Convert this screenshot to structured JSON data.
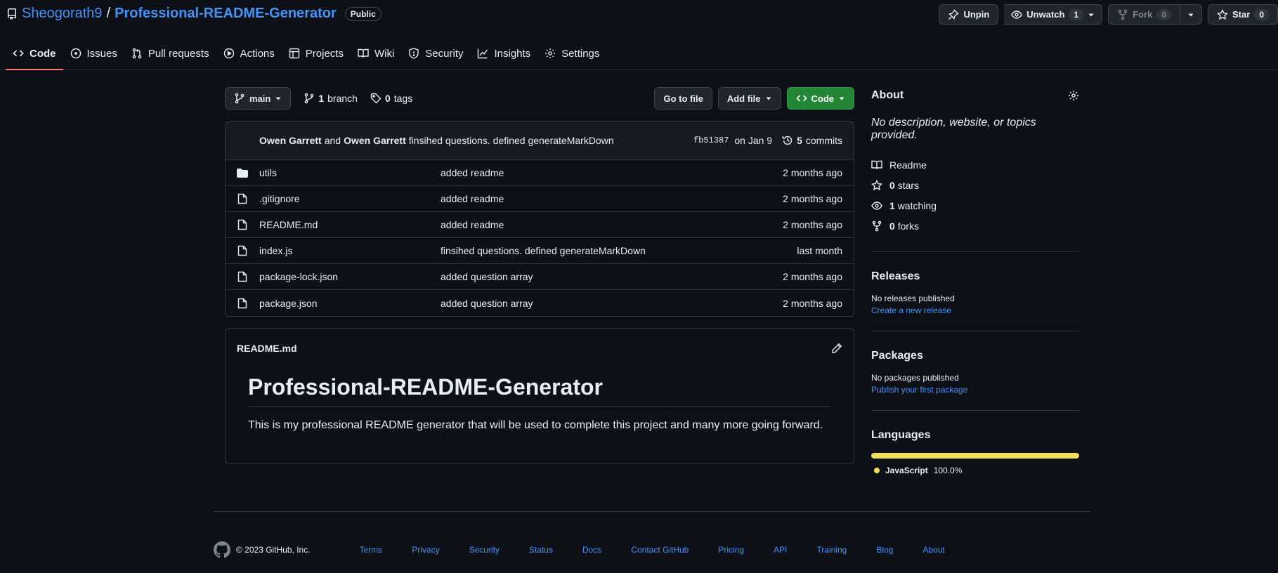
{
  "repo": {
    "owner": "Sheogorath9",
    "separator": "/",
    "name": "Professional-README-Generator",
    "visibility": "Public"
  },
  "actions": {
    "unpin": "Unpin",
    "unwatch": "Unwatch",
    "watch_count": "1",
    "fork": "Fork",
    "fork_count": "0",
    "star": "Star",
    "star_count": "0"
  },
  "tabs": [
    {
      "label": "Code"
    },
    {
      "label": "Issues"
    },
    {
      "label": "Pull requests"
    },
    {
      "label": "Actions"
    },
    {
      "label": "Projects"
    },
    {
      "label": "Wiki"
    },
    {
      "label": "Security"
    },
    {
      "label": "Insights"
    },
    {
      "label": "Settings"
    }
  ],
  "toolbar": {
    "branch": "main",
    "branch_count": "1",
    "branch_label": "branch",
    "tag_count": "0",
    "tag_label": "tags",
    "go_to_file": "Go to file",
    "add_file": "Add file",
    "code": "Code"
  },
  "commit": {
    "author1": "Owen Garrett",
    "and": "and",
    "author2": "Owen Garrett",
    "message": "finsihed questions. defined generateMarkDown",
    "sha": "fb51387",
    "date": "on Jan 9",
    "count": "5",
    "count_label": "commits"
  },
  "files": [
    {
      "type": "folder",
      "name": "utils",
      "message": "added readme",
      "age": "2 months ago"
    },
    {
      "type": "file",
      "name": ".gitignore",
      "message": "added readme",
      "age": "2 months ago"
    },
    {
      "type": "file",
      "name": "README.md",
      "message": "added readme",
      "age": "2 months ago"
    },
    {
      "type": "file",
      "name": "index.js",
      "message": "finsihed questions. defined generateMarkDown",
      "age": "last month"
    },
    {
      "type": "file",
      "name": "package-lock.json",
      "message": "added question array",
      "age": "2 months ago"
    },
    {
      "type": "file",
      "name": "package.json",
      "message": "added question array",
      "age": "2 months ago"
    }
  ],
  "readme": {
    "filename": "README.md",
    "heading": "Professional-README-Generator",
    "body": "This is my professional README generator that will be used to complete this project and many more going forward."
  },
  "about": {
    "title": "About",
    "description": "No description, website, or topics provided.",
    "readme": "Readme",
    "stars_count": "0",
    "stars_label": "stars",
    "watching_count": "1",
    "watching_label": "watching",
    "forks_count": "0",
    "forks_label": "forks"
  },
  "releases": {
    "title": "Releases",
    "text": "No releases published",
    "link": "Create a new release"
  },
  "packages": {
    "title": "Packages",
    "text": "No packages published",
    "link": "Publish your first package"
  },
  "languages": {
    "title": "Languages",
    "name": "JavaScript",
    "percent": "100.0%",
    "color": "#f1e05a"
  },
  "footer": {
    "copyright": "© 2023 GitHub, Inc.",
    "links": [
      "Terms",
      "Privacy",
      "Security",
      "Status",
      "Docs",
      "Contact GitHub",
      "Pricing",
      "API",
      "Training",
      "Blog",
      "About"
    ]
  },
  "colors": {
    "background": "#0d1117",
    "link": "#4493f8",
    "green_button": "#238636",
    "tab_underline": "#f78166"
  }
}
